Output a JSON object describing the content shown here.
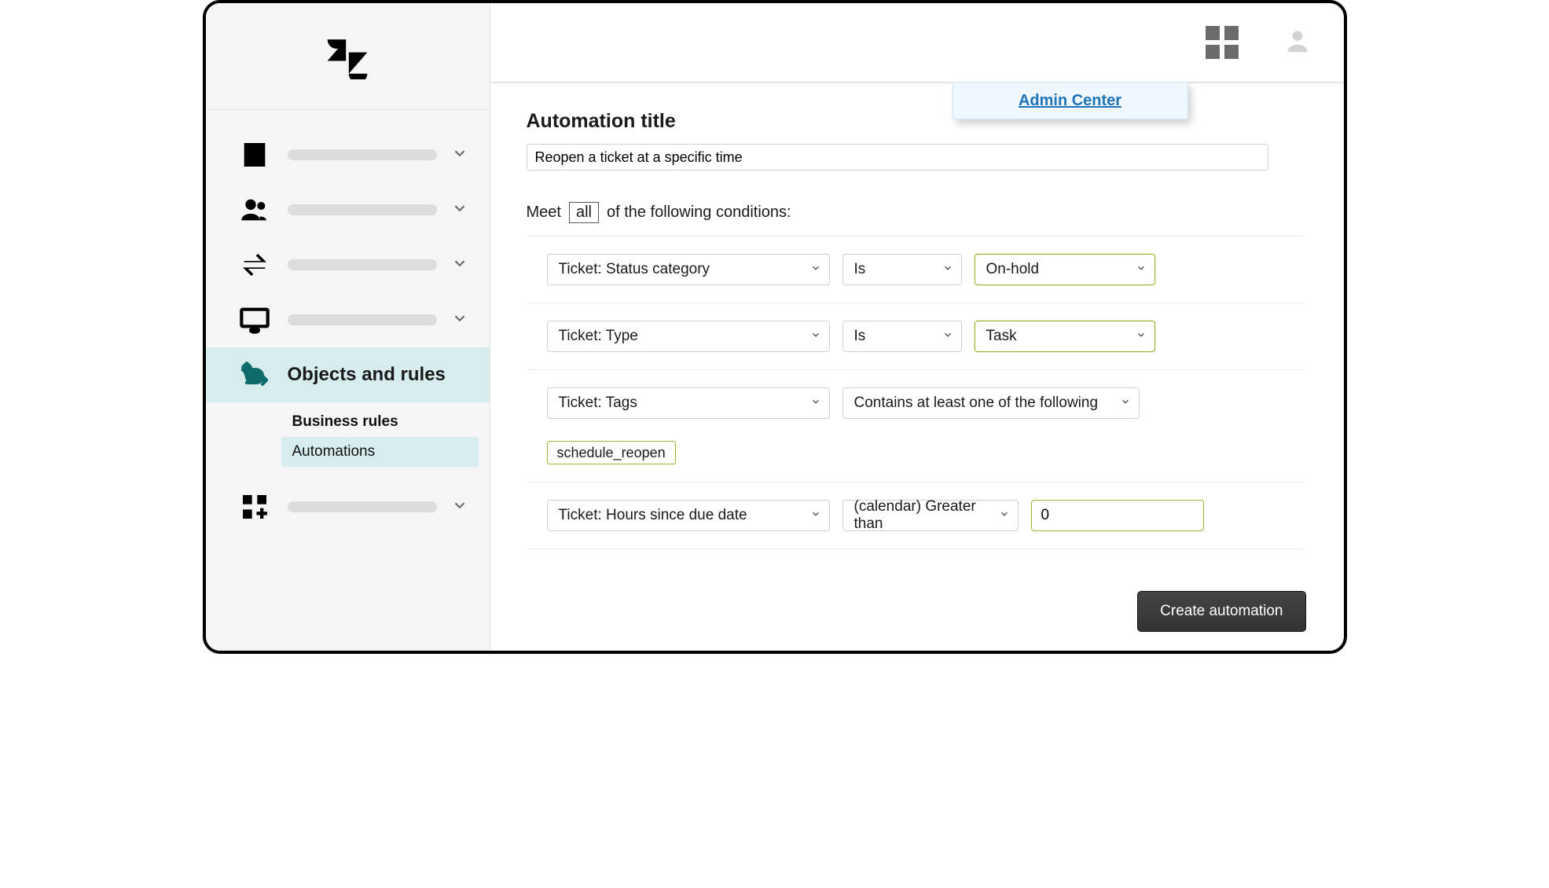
{
  "sidebar": {
    "active_label": "Objects and rules",
    "sub_items": {
      "business_rules": "Business rules",
      "automations": "Automations"
    }
  },
  "popover": {
    "link": "Admin Center"
  },
  "main": {
    "title_label": "Automation title",
    "title_value": "Reopen a ticket at a specific time",
    "meet_prefix": "Meet",
    "meet_token": "all",
    "meet_suffix": "of the following conditions:",
    "create_button": "Create automation"
  },
  "conditions": {
    "row1": {
      "field": "Ticket: Status category",
      "op": "Is",
      "value": "On-hold"
    },
    "row2": {
      "field": "Ticket: Type",
      "op": "Is",
      "value": "Task"
    },
    "row3": {
      "field": "Ticket: Tags",
      "op": "Contains at least one of the following",
      "tag": "schedule_reopen"
    },
    "row4": {
      "field": "Ticket: Hours since due date",
      "op": "(calendar) Greater than",
      "value": "0"
    }
  }
}
